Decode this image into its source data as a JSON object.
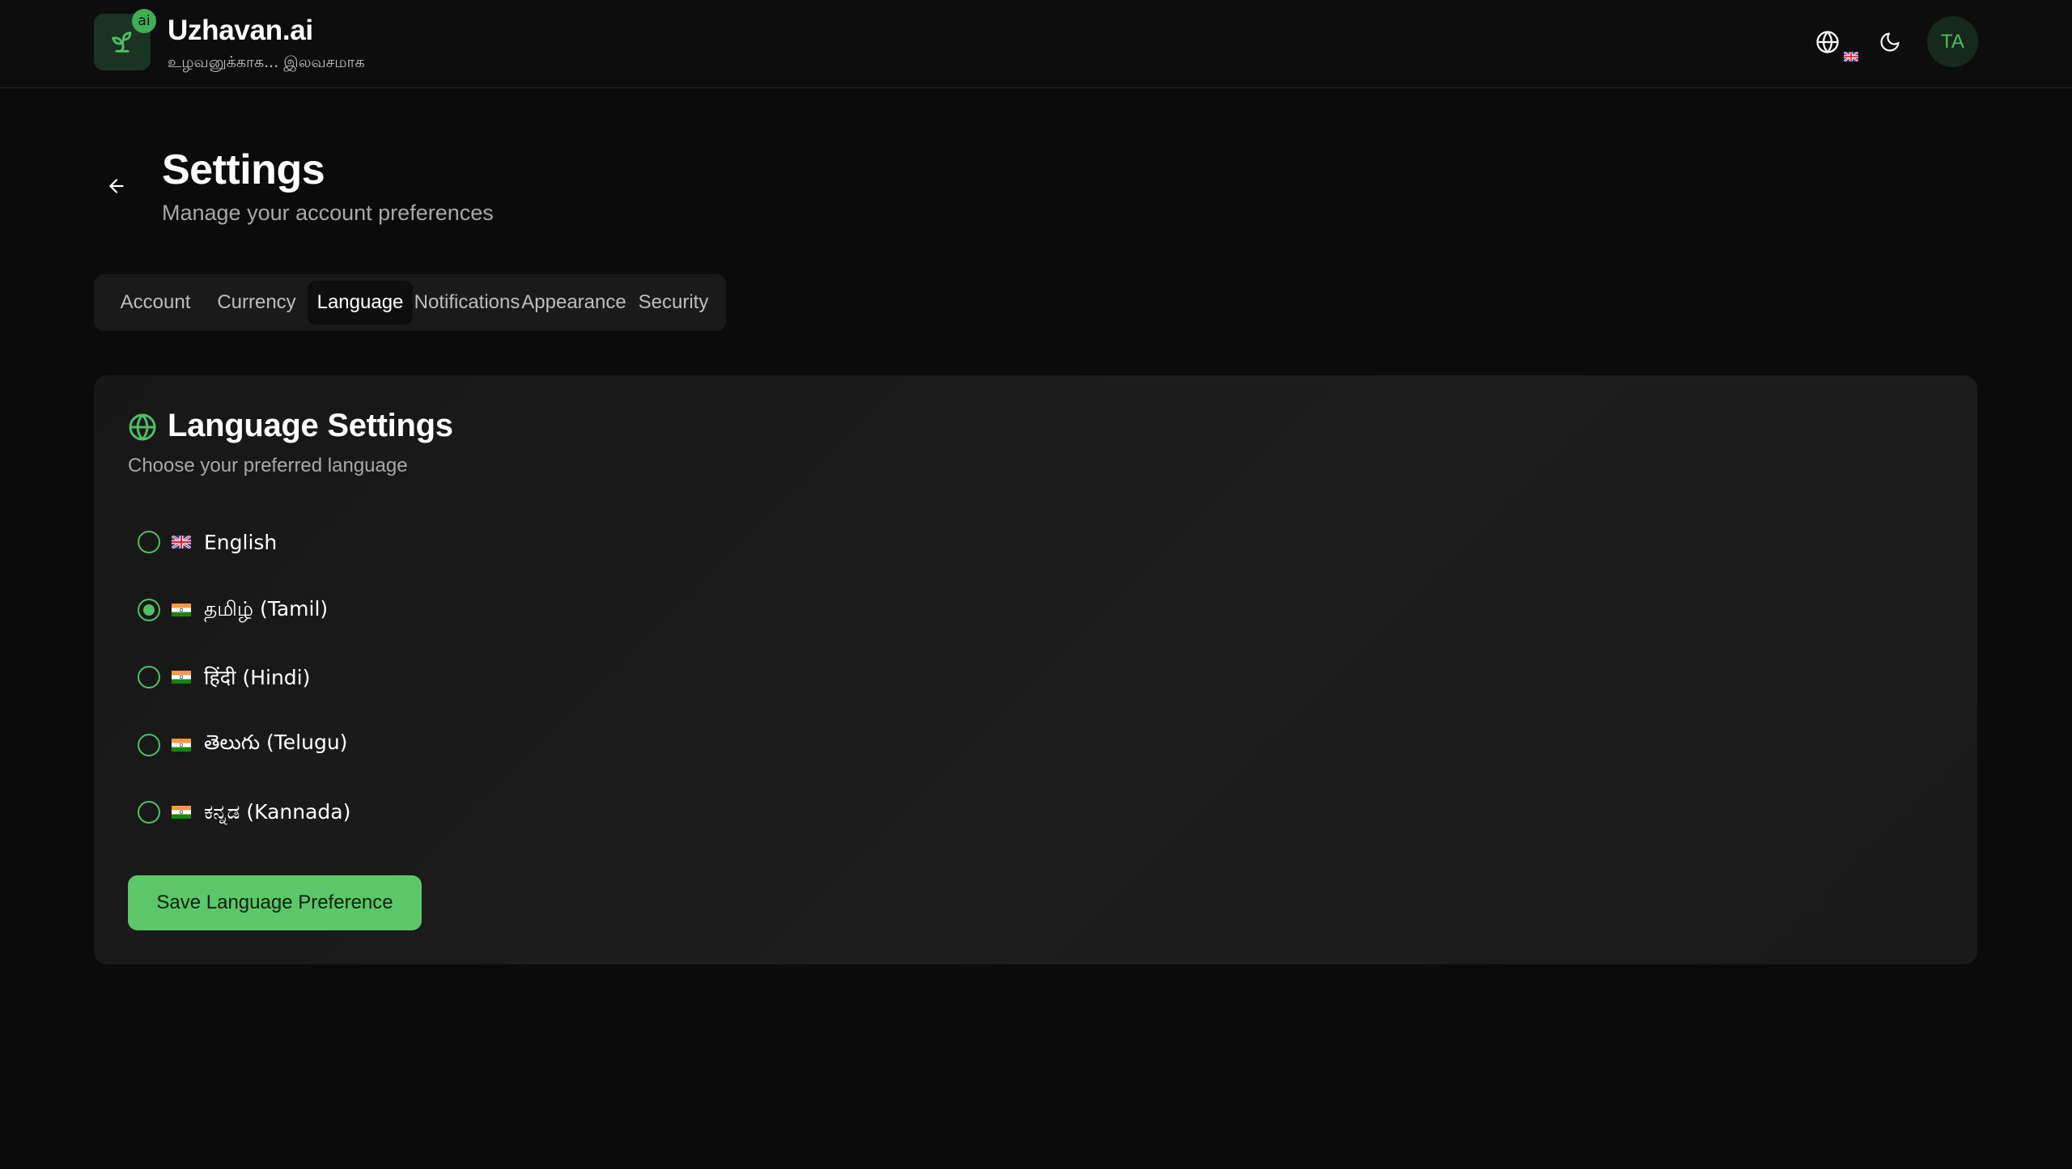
{
  "brand": {
    "title": "Uzhavan.ai",
    "subtitle": "உழவனுக்காக... இலவசமாக",
    "badge": "ai"
  },
  "header": {
    "language_icon": "globe-icon",
    "theme_icon": "moon-icon",
    "avatar_initials": "TA"
  },
  "page": {
    "title": "Settings",
    "subtitle": "Manage your account preferences"
  },
  "tabs": [
    {
      "label": "Account",
      "active": false
    },
    {
      "label": "Currency",
      "active": false
    },
    {
      "label": "Language",
      "active": true
    },
    {
      "label": "Notifications",
      "active": false
    },
    {
      "label": "Appearance",
      "active": false
    },
    {
      "label": "Security",
      "active": false
    }
  ],
  "language_card": {
    "title": "Language Settings",
    "subtitle": "Choose your preferred language",
    "options": [
      {
        "label": "English",
        "flag": "uk-flag",
        "selected": false
      },
      {
        "label": "தமிழ் (Tamil)",
        "flag": "india-flag",
        "selected": true
      },
      {
        "label": "हिंदी (Hindi)",
        "flag": "india-flag",
        "selected": false
      },
      {
        "label": "తెలుగు (Telugu)",
        "flag": "india-flag",
        "selected": false
      },
      {
        "label": "ಕನ್ನಡ (Kannada)",
        "flag": "india-flag",
        "selected": false
      }
    ],
    "save_label": "Save Language Preference"
  },
  "colors": {
    "accent": "#5cc769",
    "background": "#0b0b0b",
    "card": "#1a1a1a"
  }
}
